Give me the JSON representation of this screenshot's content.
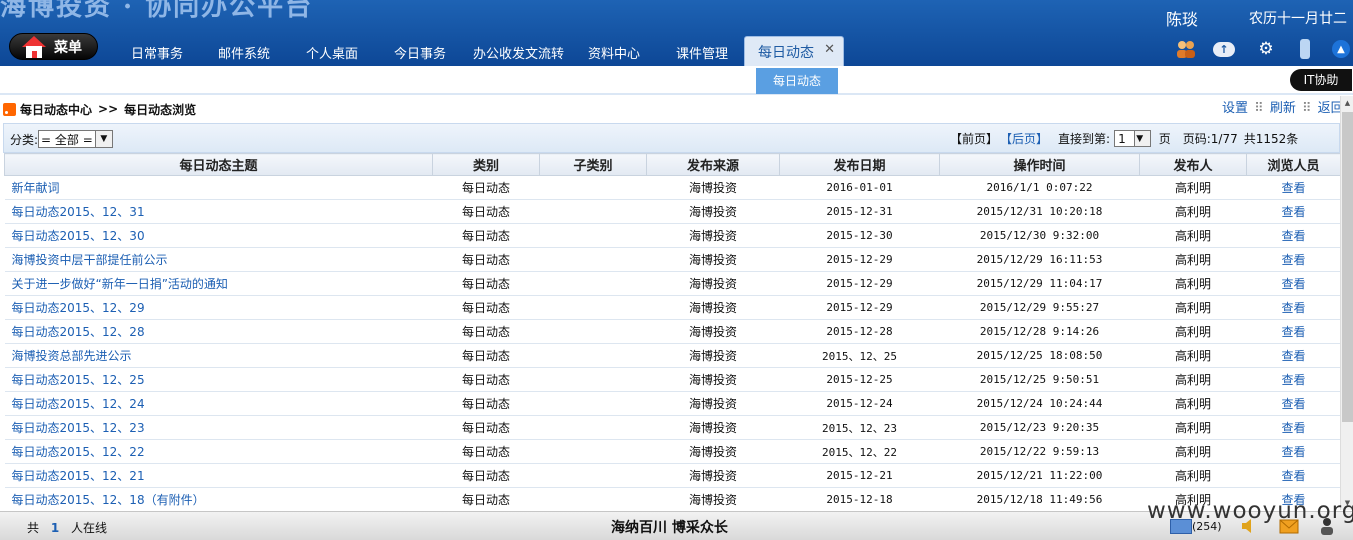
{
  "header": {
    "brand": "海博投资 · 协同办公平台",
    "user_name": "陈琰",
    "lunar_date": "农历十一月廿二",
    "menu_label": "菜单",
    "nav": [
      "日常事务",
      "邮件系统",
      "个人桌面",
      "今日事务",
      "办公收发文流转",
      "资料中心",
      "课件管理"
    ],
    "active_tab": "每日动态",
    "close_glyph": "✕"
  },
  "subnav": {
    "active": "每日动态"
  },
  "it_help": "IT协助",
  "breadcrumb": {
    "root": "每日动态中心",
    "sep": ">>",
    "current": "每日动态浏览",
    "actions": [
      "设置",
      "刷新",
      "返回"
    ]
  },
  "toolbar": {
    "category_label": "分类:",
    "category_value": "= 全部 =",
    "prev": "【前页】",
    "next": "【后页】",
    "goto_label": "直接到第:",
    "page_value": "1",
    "page_unit": "页",
    "page_info": "页码:1/77",
    "total": "共1152条"
  },
  "table": {
    "columns": [
      "每日动态主题",
      "类别",
      "子类别",
      "发布来源",
      "发布日期",
      "操作时间",
      "发布人",
      "浏览人员"
    ],
    "rows": [
      [
        "新年献词",
        "每日动态",
        "",
        "海博投资",
        "2016-01-01",
        "2016/1/1 0:07:22",
        "高利明",
        "查看"
      ],
      [
        "每日动态2015、12、31",
        "每日动态",
        "",
        "海博投资",
        "2015-12-31",
        "2015/12/31 10:20:18",
        "高利明",
        "查看"
      ],
      [
        "每日动态2015、12、30",
        "每日动态",
        "",
        "海博投资",
        "2015-12-30",
        "2015/12/30 9:32:00",
        "高利明",
        "查看"
      ],
      [
        "海博投资中层干部提任前公示",
        "每日动态",
        "",
        "海博投资",
        "2015-12-29",
        "2015/12/29 16:11:53",
        "高利明",
        "查看"
      ],
      [
        "关于进一步做好“新年一日捐”活动的通知",
        "每日动态",
        "",
        "海博投资",
        "2015-12-29",
        "2015/12/29 11:04:17",
        "高利明",
        "查看"
      ],
      [
        "每日动态2015、12、29",
        "每日动态",
        "",
        "海博投资",
        "2015-12-29",
        "2015/12/29 9:55:27",
        "高利明",
        "查看"
      ],
      [
        "每日动态2015、12、28",
        "每日动态",
        "",
        "海博投资",
        "2015-12-28",
        "2015/12/28 9:14:26",
        "高利明",
        "查看"
      ],
      [
        "海博投资总部先进公示",
        "每日动态",
        "",
        "海博投资",
        "2015、12、25",
        "2015/12/25 18:08:50",
        "高利明",
        "查看"
      ],
      [
        "每日动态2015、12、25",
        "每日动态",
        "",
        "海博投资",
        "2015-12-25",
        "2015/12/25 9:50:51",
        "高利明",
        "查看"
      ],
      [
        "每日动态2015、12、24",
        "每日动态",
        "",
        "海博投资",
        "2015-12-24",
        "2015/12/24 10:24:44",
        "高利明",
        "查看"
      ],
      [
        "每日动态2015、12、23",
        "每日动态",
        "",
        "海博投资",
        "2015、12、23",
        "2015/12/23 9:20:35",
        "高利明",
        "查看"
      ],
      [
        "每日动态2015、12、22",
        "每日动态",
        "",
        "海博投资",
        "2015、12、22",
        "2015/12/22 9:59:13",
        "高利明",
        "查看"
      ],
      [
        "每日动态2015、12、21",
        "每日动态",
        "",
        "海博投资",
        "2015-12-21",
        "2015/12/21 11:22:00",
        "高利明",
        "查看"
      ],
      [
        "每日动态2015、12、18（有附件）",
        "每日动态",
        "",
        "海博投资",
        "2015-12-18",
        "2015/12/18 11:49:56",
        "高利明",
        "查看"
      ]
    ]
  },
  "footer": {
    "online_prefix": "共",
    "online_count": "1",
    "online_suffix": "人在线",
    "slogan": "海纳百川 博采众长",
    "mail_count": "(254)",
    "watermark": "www.wooyun.org"
  },
  "icons": [
    "home-icon",
    "team-icon",
    "upload-cloud-icon",
    "gear-icon",
    "key-icon",
    "collapse-up-icon",
    "rss-icon",
    "mail-icon",
    "speaker-icon",
    "message-icon",
    "user-icon"
  ]
}
